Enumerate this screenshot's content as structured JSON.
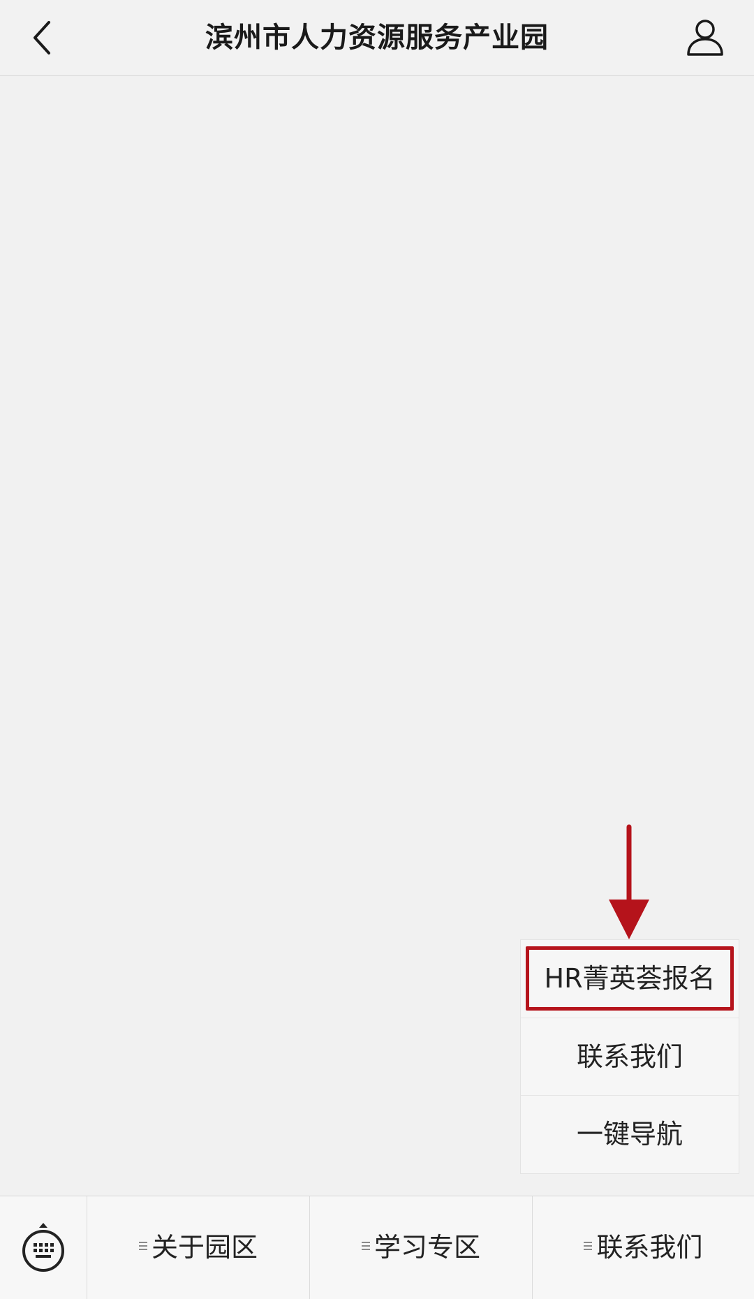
{
  "header": {
    "title": "滨州市人力资源服务产业园",
    "back_icon": "chevron-left-icon",
    "profile_icon": "user-icon"
  },
  "submenu": {
    "items": [
      {
        "label": "HR菁英荟报名"
      },
      {
        "label": "联系我们"
      },
      {
        "label": "一键导航"
      }
    ],
    "highlight_color": "#b5131b"
  },
  "bottom_menu": {
    "keyboard_icon": "keyboard-icon",
    "tabs": [
      {
        "label": "关于园区"
      },
      {
        "label": "学习专区"
      },
      {
        "label": "联系我们"
      }
    ]
  },
  "colors": {
    "background": "#f1f1f1",
    "annotation_red": "#b5131b"
  }
}
